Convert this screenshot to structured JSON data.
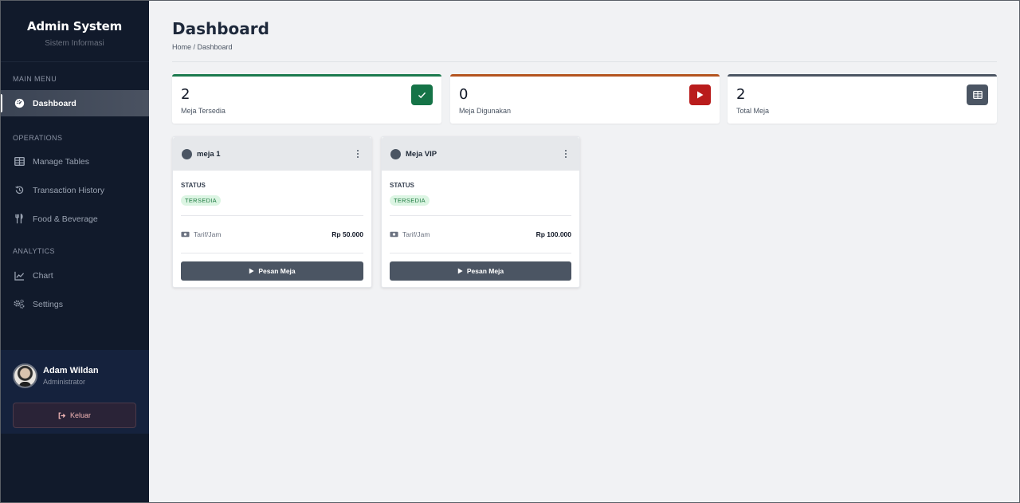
{
  "sidebar": {
    "brand_title": "Admin System",
    "brand_subtitle": "Sistem Informasi",
    "sections": {
      "main_menu": "MAIN MENU",
      "operations": "OPERATIONS",
      "analytics": "ANALYTICS"
    },
    "items": [
      {
        "label": "Dashboard",
        "icon": "gauge-icon"
      },
      {
        "label": "Manage Tables",
        "icon": "table-icon"
      },
      {
        "label": "Transaction History",
        "icon": "history-icon"
      },
      {
        "label": "Food & Beverage",
        "icon": "utensils-icon"
      },
      {
        "label": "Chart",
        "icon": "line-chart-icon"
      },
      {
        "label": "Settings",
        "icon": "gears-icon"
      }
    ],
    "user": {
      "name": "Adam Wildan",
      "role": "Administrator",
      "logout_label": "Keluar"
    }
  },
  "header": {
    "title": "Dashboard",
    "breadcrumb": "Home / Dashboard"
  },
  "stats": [
    {
      "value": "2",
      "label": "Meja Tersedia",
      "color": "#1c7a4e",
      "icon": "check-icon"
    },
    {
      "value": "0",
      "label": "Meja Digunakan",
      "color": "#b4541f",
      "icon": "play-icon"
    },
    {
      "value": "2",
      "label": "Total Meja",
      "color": "#4b5563",
      "icon": "table-icon"
    }
  ],
  "tables": [
    {
      "name": "meja 1",
      "status_label": "STATUS",
      "status": "TERSEDIA",
      "rate_label": "Tarif/Jam",
      "rate": "Rp 50.000",
      "button": "Pesan Meja"
    },
    {
      "name": "Meja VIP",
      "status_label": "STATUS",
      "status": "TERSEDIA",
      "rate_label": "Tarif/Jam",
      "rate": "Rp 100.000",
      "button": "Pesan Meja"
    }
  ],
  "colors": {
    "sidebar_bg": "#111a2b",
    "badge_green": "#157347",
    "badge_red": "#b91c1c",
    "badge_gray": "#4b5563"
  }
}
